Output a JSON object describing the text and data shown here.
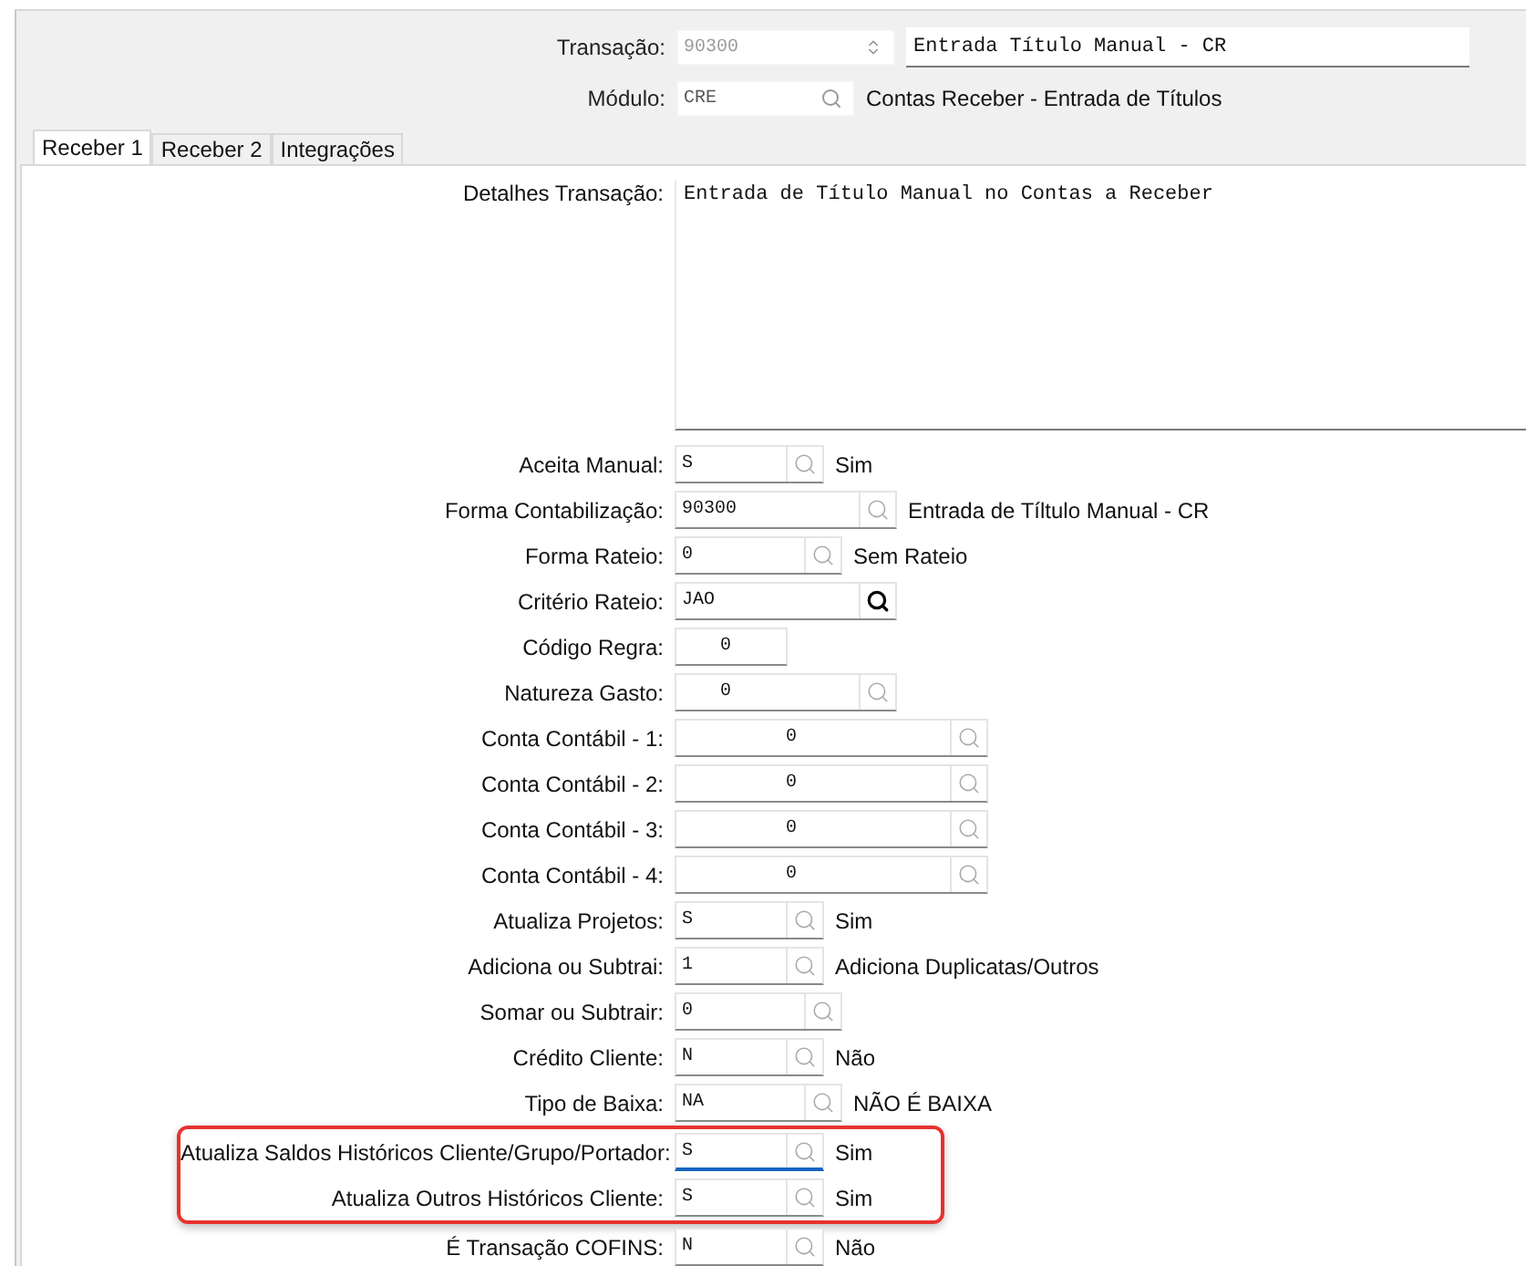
{
  "header": {
    "transaction": {
      "label": "Transação:",
      "code": "90300",
      "code_disabled": true,
      "description": "Entrada Título Manual - CR"
    },
    "module": {
      "label": "Módulo:",
      "code": "CRE",
      "description": "Contas Receber - Entrada de Títulos"
    }
  },
  "tabs": [
    {
      "label": "Receber 1",
      "selected": true
    },
    {
      "label": "Receber 2",
      "selected": false
    },
    {
      "label": "Integrações",
      "selected": false
    }
  ],
  "details": {
    "label": "Detalhes Transação:",
    "value": "Entrada de Título Manual no Contas a Receber"
  },
  "fields": [
    {
      "label": "Aceita Manual:",
      "value": "S",
      "kind": "code",
      "focused": false,
      "highlighted": false,
      "description": "Sim"
    },
    {
      "label": "Forma Contabilização:",
      "value": "90300",
      "kind": "lookup",
      "focused": false,
      "highlighted": false,
      "description": "Entrada de Tíltulo Manual - CR"
    },
    {
      "label": "Forma Rateio:",
      "value": "0",
      "kind": "choice",
      "focused": false,
      "highlighted": false,
      "description": "Sem Rateio"
    },
    {
      "label": "Critério Rateio:",
      "value": "JAO",
      "kind": "picked",
      "focused": false,
      "highlighted": false
    },
    {
      "label": "Código Regra:",
      "value": "0",
      "kind": "number",
      "focused": false,
      "highlighted": false
    },
    {
      "label": "Natureza Gasto:",
      "value": "0",
      "kind": "numlookup",
      "focused": false,
      "highlighted": false
    },
    {
      "label": "Conta Contábil - 1:",
      "value": "0",
      "kind": "account",
      "focused": false,
      "highlighted": false
    },
    {
      "label": "Conta Contábil - 2:",
      "value": "0",
      "kind": "account",
      "focused": false,
      "highlighted": false
    },
    {
      "label": "Conta Contábil - 3:",
      "value": "0",
      "kind": "account",
      "focused": false,
      "highlighted": false
    },
    {
      "label": "Conta Contábil - 4:",
      "value": "0",
      "kind": "account",
      "focused": false,
      "highlighted": false
    },
    {
      "label": "Atualiza Projetos:",
      "value": "S",
      "kind": "code",
      "focused": false,
      "highlighted": false,
      "description": "Sim"
    },
    {
      "label": "Adiciona ou Subtrai:",
      "value": "1",
      "kind": "code",
      "focused": false,
      "highlighted": false,
      "description": "Adiciona Duplicatas/Outros"
    },
    {
      "label": "Somar ou Subtrair:",
      "value": "0",
      "kind": "choice",
      "focused": false,
      "highlighted": false
    },
    {
      "label": "Crédito Cliente:",
      "value": "N",
      "kind": "code",
      "focused": false,
      "highlighted": false,
      "description": "Não"
    },
    {
      "label": "Tipo de Baixa:",
      "value": "NA",
      "kind": "choice",
      "focused": false,
      "highlighted": false,
      "description": "NÃO É BAIXA"
    },
    {
      "label": "Atualiza Saldos Históricos Cliente/Grupo/Portador:",
      "value": "S",
      "kind": "code",
      "focused": true,
      "highlighted": true,
      "description": "Sim"
    },
    {
      "label": "Atualiza Outros Históricos Cliente:",
      "value": "S",
      "kind": "code",
      "focused": false,
      "highlighted": true,
      "description": "Sim"
    },
    {
      "label": "É Transação COFINS:",
      "value": "N",
      "kind": "code",
      "focused": false,
      "highlighted": false,
      "description": "Não"
    }
  ]
}
